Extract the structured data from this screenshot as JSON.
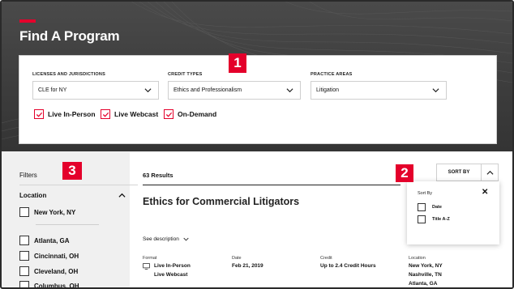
{
  "page": {
    "title": "Find A Program",
    "accent_color": "#e4002b"
  },
  "search": {
    "licenses_label": "LICENSES AND JURISDICTIONS",
    "licenses_value": "CLE for NY",
    "credit_label": "CREDIT TYPES",
    "credit_value": "Ethics and Professionalism",
    "practice_label": "PRACTICE AREAS",
    "practice_value": "Litigation",
    "formats": [
      "Live In-Person",
      "Live Webcast",
      "On-Demand"
    ]
  },
  "markers": [
    "1",
    "2",
    "3"
  ],
  "filters": {
    "title": "Filters",
    "location_title": "Location",
    "selected": "New York, NY",
    "locations": [
      "Atlanta, GA",
      "Cincinnati, OH",
      "Cleveland, OH",
      "Columbus, OH"
    ]
  },
  "results": {
    "count_text": "63 Results",
    "sort_label": "SORT BY"
  },
  "sort_panel": {
    "title": "Sort By",
    "options": [
      "Date",
      "Title A-Z"
    ]
  },
  "course": {
    "title": "Ethics for Commercial Litigators",
    "see_description": "See description",
    "format_label": "Format",
    "format_values": [
      "Live In-Person",
      "Live Webcast"
    ],
    "date_label": "Date",
    "date_value": "Feb 21, 2019",
    "credit_label": "Credit",
    "credit_value": "Up to 2.4 Credit Hours",
    "location_label": "Location",
    "location_values": [
      "New York, NY",
      "Nashville, TN",
      "Atlanta, GA"
    ]
  }
}
